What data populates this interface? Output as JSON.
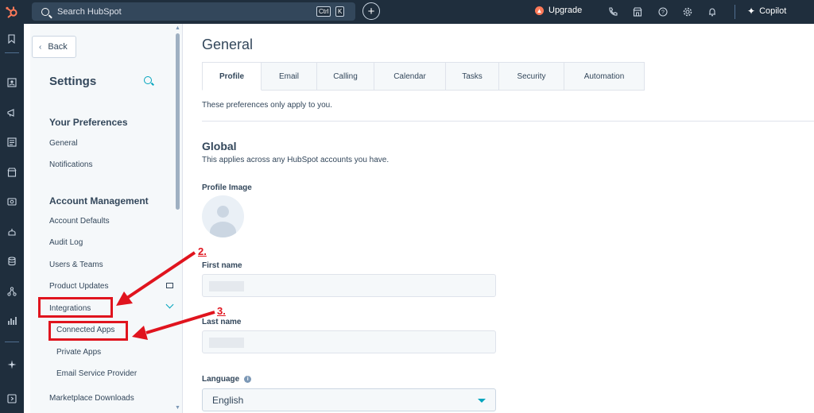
{
  "topbar": {
    "search_placeholder": "Search HubSpot",
    "shortcut_ctrl": "Ctrl",
    "shortcut_key": "K",
    "add_label": "+",
    "upgrade_label": "Upgrade",
    "copilot_label": "Copilot",
    "icons": [
      "phone-icon",
      "marketplace-icon",
      "help-icon",
      "settings-icon",
      "notifications-icon"
    ]
  },
  "rail": {
    "icons": [
      "bookmark-icon",
      "contacts-icon",
      "marketing-icon",
      "content-icon",
      "commerce-icon",
      "service-icon",
      "automation-icon",
      "data-icon",
      "workflows-icon",
      "reporting-icon",
      "breeze-icon",
      "expand-icon"
    ]
  },
  "sidebar": {
    "back_label": "Back",
    "title": "Settings",
    "sections": [
      {
        "heading": "Your Preferences",
        "items": [
          "General",
          "Notifications"
        ]
      },
      {
        "heading": "Account Management",
        "items": [
          "Account Defaults",
          "Audit Log",
          "Users & Teams",
          "Product Updates",
          "Integrations"
        ]
      }
    ],
    "integrations_sub": [
      "Connected Apps",
      "Private Apps",
      "Email Service Provider"
    ],
    "extra_item": "Marketplace Downloads"
  },
  "annotations": {
    "step2": "2.",
    "step3": "3.",
    "color": "#e0141e"
  },
  "main": {
    "title": "General",
    "tabs": [
      "Profile",
      "Email",
      "Calling",
      "Calendar",
      "Tasks",
      "Security",
      "Automation"
    ],
    "active_tab": "Profile",
    "pref_note": "These preferences only apply to you.",
    "global_heading": "Global",
    "global_desc": "This applies across any HubSpot accounts you have.",
    "profile_image_label": "Profile Image",
    "first_name_label": "First name",
    "last_name_label": "Last name",
    "language_label": "Language",
    "language_value": "English"
  },
  "colors": {
    "nav_dark": "#1f2e3d",
    "accent": "#00a4bd",
    "brand": "#ff7a59",
    "text": "#33475b"
  }
}
